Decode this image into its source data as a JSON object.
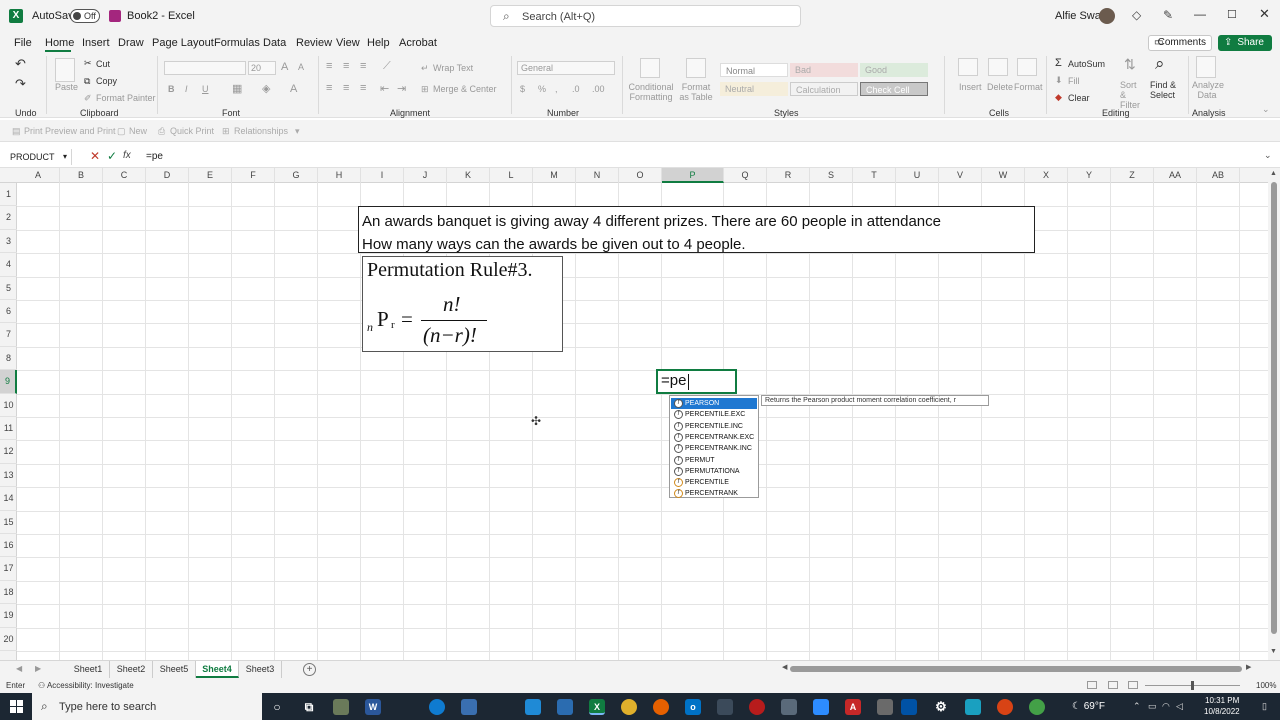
{
  "titlebar": {
    "autosave_label": "AutoSave",
    "autosave_state": "Off",
    "doc_title": "Book2  -  Excel",
    "search_placeholder": "Search (Alt+Q)",
    "user_name": "Alfie Swan"
  },
  "menu": {
    "tabs": [
      "File",
      "Home",
      "Insert",
      "Draw",
      "Page Layout",
      "Formulas",
      "Data",
      "Review",
      "View",
      "Help",
      "Acrobat"
    ],
    "active_tab": "Home",
    "comments_label": "Comments",
    "share_label": "Share"
  },
  "ribbon": {
    "undo_group": "Undo",
    "clipboard": {
      "paste": "Paste",
      "cut": "Cut",
      "copy": "Copy",
      "format_painter": "Format Painter",
      "label": "Clipboard"
    },
    "font": {
      "font_size": "20",
      "label": "Font"
    },
    "alignment": {
      "wrap_text": "Wrap Text",
      "merge_center": "Merge & Center",
      "label": "Alignment"
    },
    "number": {
      "format": "General",
      "label": "Number"
    },
    "styles": {
      "conditional_formatting": "Conditional Formatting",
      "format_as_table": "Format as Table",
      "cells": [
        "Normal",
        "Bad",
        "Good",
        "Neutral",
        "Calculation",
        "Check Cell"
      ],
      "label": "Styles"
    },
    "cells": {
      "insert": "Insert",
      "delete": "Delete",
      "format": "Format",
      "label": "Cells"
    },
    "editing": {
      "autosum": "AutoSum",
      "fill": "Fill",
      "clear": "Clear",
      "sort_filter": "Sort & Filter",
      "find_select": "Find & Select",
      "label": "Editing"
    },
    "analysis": {
      "analyze_data": "Analyze Data",
      "label": "Analysis"
    }
  },
  "qat": {
    "items": [
      "Print Preview and Print",
      "New",
      "Quick Print",
      "Relationships"
    ]
  },
  "formula_bar": {
    "name_box": "PRODUCT",
    "fx": "fx",
    "value": "=pe"
  },
  "columns": [
    "A",
    "B",
    "C",
    "D",
    "E",
    "F",
    "G",
    "H",
    "I",
    "J",
    "K",
    "L",
    "M",
    "N",
    "O",
    "P",
    "Q",
    "R",
    "S",
    "T",
    "U",
    "V",
    "W",
    "X",
    "Y",
    "Z",
    "AA",
    "AB"
  ],
  "rows": [
    "1",
    "2",
    "3",
    "4",
    "5",
    "6",
    "7",
    "8",
    "9",
    "10",
    "11",
    "12",
    "13",
    "14",
    "15",
    "16",
    "17",
    "18",
    "19",
    "20"
  ],
  "selected_column": "P",
  "selected_row": "9",
  "sheet": {
    "problem_line1": "An awards banquet is giving away 4 different prizes. There are 60 people in attendance",
    "problem_line2": "How many ways can the awards be given out to 4 people.",
    "rule_title": "Permutation Rule#3.",
    "formula": {
      "n_sub": "n",
      "P": "P",
      "r_sub": "r",
      "eq": "=",
      "numerator": "n!",
      "denominator": "(n−r)!"
    },
    "active_cell_text": "=pe"
  },
  "autocomplete": {
    "items": [
      "PEARSON",
      "PERCENTILE.EXC",
      "PERCENTILE.INC",
      "PERCENTRANK.EXC",
      "PERCENTRANK.INC",
      "PERMUT",
      "PERMUTATIONA",
      "PERCENTILE",
      "PERCENTRANK"
    ],
    "selected": "PEARSON",
    "tooltip": "Returns the Pearson product moment correlation coefficient, r"
  },
  "sheet_tabs": [
    "Sheet1",
    "Sheet2",
    "Sheet5",
    "Sheet4",
    "Sheet3"
  ],
  "active_sheet": "Sheet4",
  "status": {
    "mode": "Enter",
    "accessibility": "Accessibility: Investigate",
    "zoom": "100%"
  },
  "taskbar": {
    "search_placeholder": "Type here to search",
    "weather": "69°F",
    "time": "10:31 PM",
    "date": "10/8/2022"
  },
  "colors": {
    "excel_green": "#107c41",
    "selection_blue": "#1f78d1",
    "taskbar": "#1c2733"
  }
}
